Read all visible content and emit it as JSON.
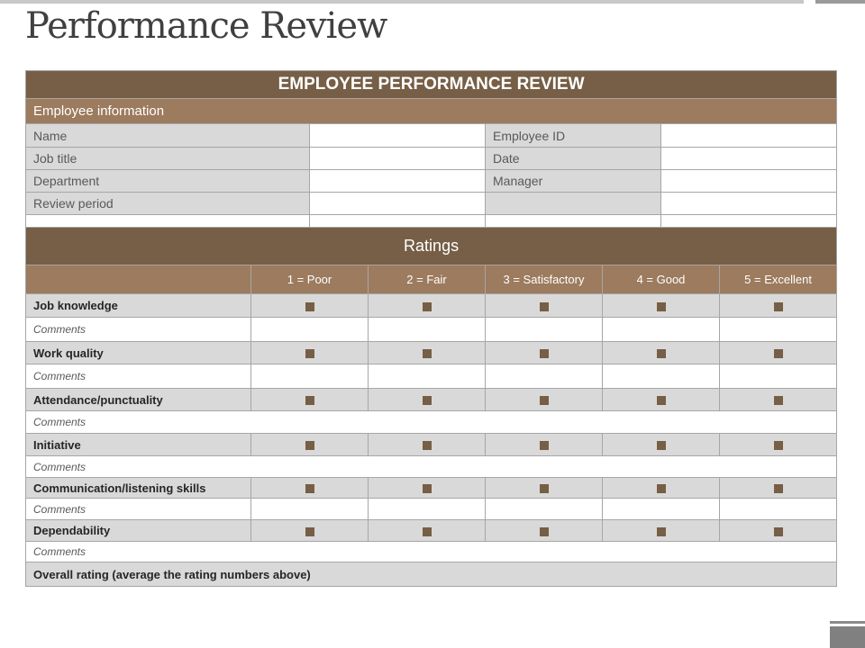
{
  "page_title": "Performance Review",
  "form": {
    "title": "EMPLOYEE PERFORMANCE REVIEW",
    "section_info": "Employee information",
    "info_rows": [
      {
        "l1": "Name",
        "l2": "Employee ID"
      },
      {
        "l1": "Job title",
        "l2": "Date"
      },
      {
        "l1": "Department",
        "l2": "Manager"
      },
      {
        "l1": "Review period",
        "l2": ""
      }
    ],
    "section_ratings": "Ratings",
    "scale": [
      "1 = Poor",
      "2 = Fair",
      "3 = Satisfactory",
      "4 = Good",
      "5 = Excellent"
    ],
    "criteria": [
      "Job knowledge",
      "Work quality",
      "Attendance/punctuality",
      "Initiative",
      "Communication/listening skills",
      "Dependability"
    ],
    "comments_label": "Comments",
    "overall": "Overall rating (average the rating numbers above)"
  },
  "colors": {
    "dark": "#765f46",
    "light": "#9c7b5e",
    "gray": "#d9d9d9"
  }
}
